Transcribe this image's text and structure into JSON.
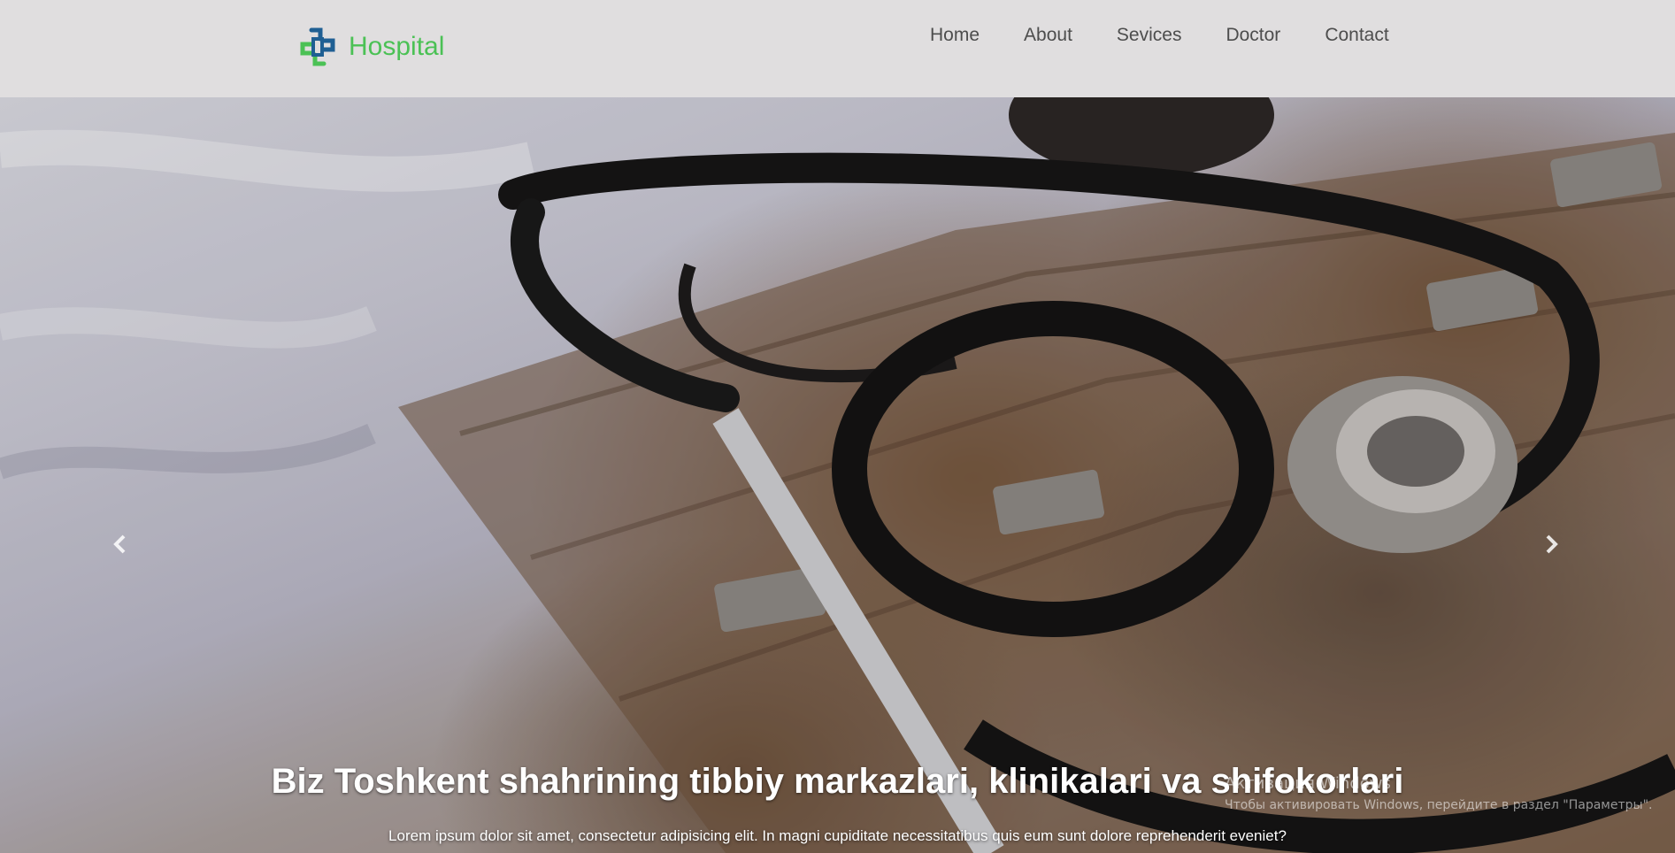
{
  "brand": {
    "name": "Hospital",
    "logo_icon": "medical-cross-logo-icon"
  },
  "nav": {
    "items": [
      {
        "label": "Home"
      },
      {
        "label": "About"
      },
      {
        "label": "Sevices"
      },
      {
        "label": "Doctor"
      },
      {
        "label": "Contact"
      }
    ]
  },
  "carousel": {
    "prev_icon": "chevron-left-icon",
    "next_icon": "chevron-right-icon",
    "slide_image": "stethoscope-photo",
    "caption_title": "Biz Toshkent shahrining tibbiy markazlari, klinikalari va shifokorlari",
    "caption_text": "Lorem ipsum dolor sit amet, consectetur adipisicing elit. In magni cupiditate necessitatibus quis eum sunt dolore reprehenderit eveniet?"
  },
  "windows_watermark": {
    "title": "Активация Windows",
    "text": "Чтобы активировать Windows, перейдите в раздел \"Параметры\"."
  },
  "colors": {
    "navbar_bg": "#e0dedf",
    "brand_green": "#4bc155",
    "brand_blue": "#1f5f93",
    "nav_text": "#4d4d4d",
    "caption_text": "#ffffff"
  }
}
